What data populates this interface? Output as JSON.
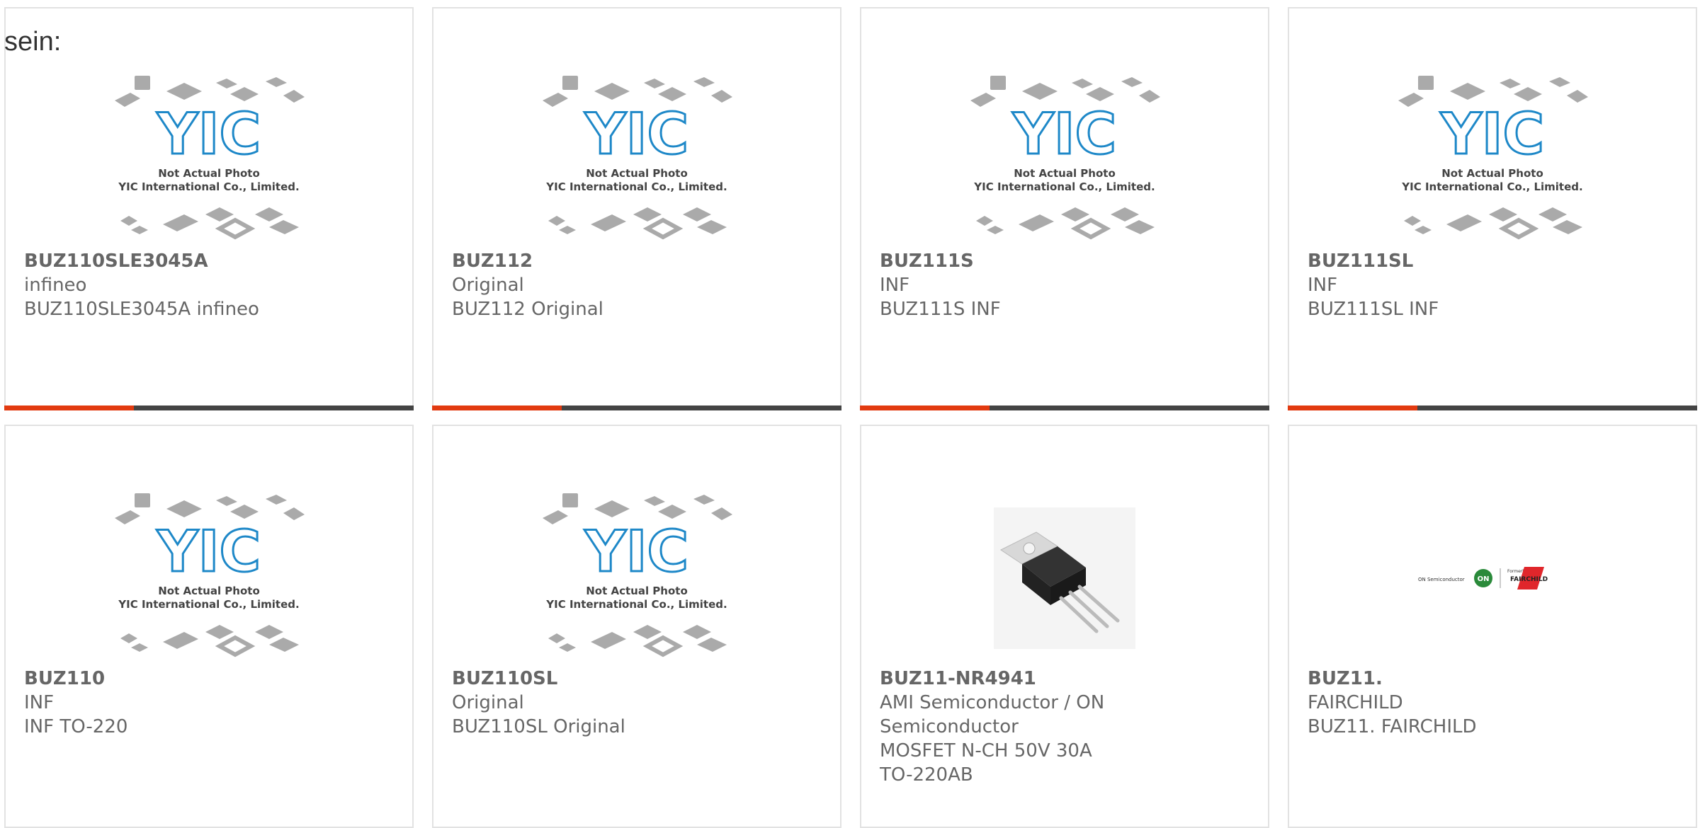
{
  "lead_text": "sein:",
  "placeholder_image": {
    "caption_line1": "Not Actual Photo",
    "caption_line2": "YIC International Co., Limited.",
    "logo_text": "YIC"
  },
  "colors": {
    "accent": "#e23a10",
    "bar": "#444444",
    "logo_blue": "#1e88c8"
  },
  "products": [
    {
      "part": "BUZ110SLE3045A",
      "brand": "infineo",
      "desc": "BUZ110SLE3045A infineo",
      "image": "yic-placeholder"
    },
    {
      "part": "BUZ112",
      "brand": "Original",
      "desc": "BUZ112 Original",
      "image": "yic-placeholder"
    },
    {
      "part": "BUZ111S",
      "brand": "INF",
      "desc": "BUZ111S INF",
      "image": "yic-placeholder"
    },
    {
      "part": "BUZ111SL",
      "brand": "INF",
      "desc": "BUZ111SL INF",
      "image": "yic-placeholder"
    },
    {
      "part": "BUZ110",
      "brand": "INF",
      "desc": "INF TO-220",
      "image": "yic-placeholder"
    },
    {
      "part": "BUZ110SL",
      "brand": "Original",
      "desc": "BUZ110SL Original",
      "image": "yic-placeholder"
    },
    {
      "part": "BUZ11-NR4941",
      "brand": "AMI Semiconductor / ON Semiconductor",
      "desc": "MOSFET N-CH 50V 30A TO-220AB",
      "image": "to220-transistor"
    },
    {
      "part": "BUZ11.",
      "brand": "FAIRCHILD",
      "desc": "BUZ11. FAIRCHILD",
      "image": "on-fairchild-logo"
    }
  ],
  "fairchild_logo": {
    "left": "ON Semiconductor",
    "badge": "ON",
    "small": "Formerly",
    "right": "FAIRCHILD"
  }
}
